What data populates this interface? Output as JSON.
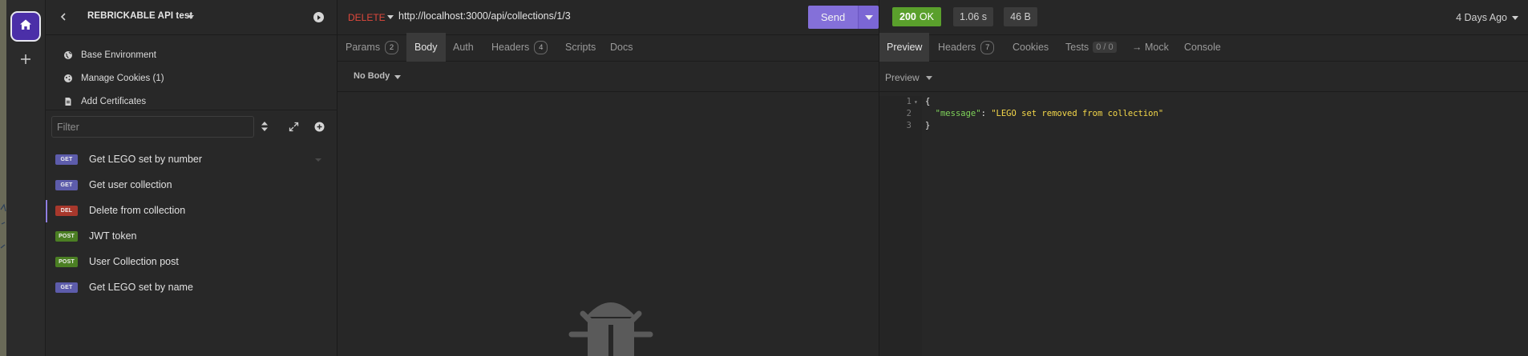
{
  "rail": {
    "home_icon": "home-icon",
    "add_icon": "plus-icon"
  },
  "sidebar": {
    "project_title": "REBRICKABLE API test",
    "menu": [
      {
        "label": "Base Environment",
        "icon": "globe-icon"
      },
      {
        "label": "Manage Cookies (1)",
        "icon": "cookie-icon"
      },
      {
        "label": "Add Certificates",
        "icon": "certificate-icon"
      }
    ],
    "filter_placeholder": "Filter",
    "requests": [
      {
        "method": "GET",
        "name": "Get LEGO set by number",
        "color": "#5d5cab"
      },
      {
        "method": "GET",
        "name": "Get user collection",
        "color": "#5d5cab"
      },
      {
        "method": "DEL",
        "name": "Delete from collection",
        "color": "#a8382c",
        "active": true
      },
      {
        "method": "POST",
        "name": "JWT token",
        "color": "#4b7f23"
      },
      {
        "method": "POST",
        "name": "User Collection post",
        "color": "#4b7f23"
      },
      {
        "method": "GET",
        "name": "Get LEGO set by name",
        "color": "#5d5cab"
      }
    ]
  },
  "request": {
    "method": "DELETE",
    "url": "http://localhost:3000/api/collections/1/3",
    "send_label": "Send",
    "tabs": {
      "params": "Params",
      "params_count": "2",
      "body": "Body",
      "auth": "Auth",
      "headers": "Headers",
      "headers_count": "4",
      "scripts": "Scripts",
      "docs": "Docs"
    },
    "body_type": "No Body"
  },
  "response": {
    "status_code": "200",
    "status_text": "OK",
    "time": "1.06 s",
    "size": "46 B",
    "age": "4 Days Ago",
    "tabs": {
      "preview": "Preview",
      "headers": "Headers",
      "headers_count": "7",
      "cookies": "Cookies",
      "tests": "Tests",
      "tests_ratio": "0 / 0",
      "mock": "→ Mock",
      "console": "Console"
    },
    "preview_mode": "Preview",
    "code": {
      "ln1": "1",
      "ln2": "2",
      "ln3": "3",
      "open": "{",
      "key": "\"message\"",
      "colon": ": ",
      "value": "\"LEGO set removed from collection\"",
      "close": "}"
    }
  },
  "colors": {
    "accent": "#8470d9",
    "ok": "#5aa02c",
    "delete": "#e0483c"
  }
}
